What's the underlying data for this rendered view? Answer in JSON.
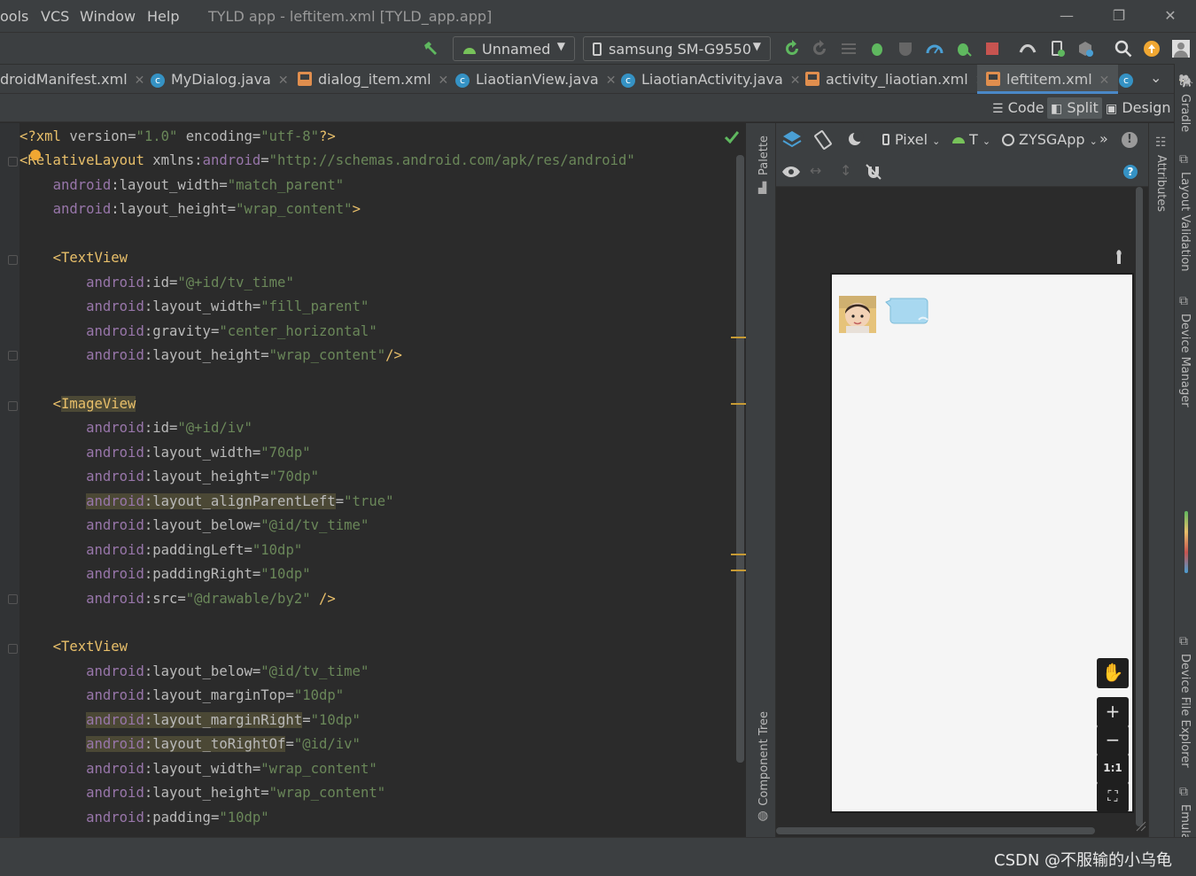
{
  "menu": {
    "items": [
      "ools",
      "VCS",
      "Window",
      "Help"
    ],
    "title": "TYLD app - leftitem.xml [TYLD_app.app]"
  },
  "toolbar": {
    "config_label": "Unnamed",
    "device_label": "samsung SM-G9550"
  },
  "tabs": [
    {
      "label": "droidManifest.xml",
      "kind": "xml"
    },
    {
      "label": "MyDialog.java",
      "kind": "class"
    },
    {
      "label": "dialog_item.xml",
      "kind": "xml"
    },
    {
      "label": "LiaotianView.java",
      "kind": "class"
    },
    {
      "label": "LiaotianActivity.java",
      "kind": "class"
    },
    {
      "label": "activity_liaotian.xml",
      "kind": "xml"
    },
    {
      "label": "leftitem.xml",
      "kind": "xml",
      "active": true
    }
  ],
  "modes": {
    "code": "Code",
    "split": "Split",
    "design": "Design",
    "active": "Split"
  },
  "design_toolbar": {
    "device": "Pixel",
    "api": "T",
    "theme": "ZYSGApp"
  },
  "side_panels": {
    "palette": "Palette",
    "component_tree": "Component Tree",
    "attributes": "Attributes",
    "gradle": "Gradle",
    "layout_validation": "Layout Validation",
    "device_manager": "Device Manager",
    "device_file_explorer": "Device File Explorer",
    "emulator": "Emulator"
  },
  "zoom": {
    "in": "+",
    "out": "−",
    "one_to_one": "1:1"
  },
  "watermark": "CSDN @不服输的小乌龟",
  "colors": {
    "accent": "#4a88c7",
    "tag": "#e8bf6a",
    "attr_ns": "#9876aa",
    "value": "#6a8759",
    "warning": "#c79b35"
  },
  "code_lines": [
    {
      "parts": [
        [
          "pn",
          "<?"
        ],
        [
          "tg",
          "xml "
        ],
        [
          "at",
          "version"
        ],
        [
          "pl",
          "="
        ],
        [
          "av",
          "\"1.0\""
        ],
        [
          "at",
          " encoding"
        ],
        [
          "pl",
          "="
        ],
        [
          "av",
          "\"utf-8\""
        ],
        [
          "pn",
          "?>"
        ]
      ]
    },
    {
      "parts": [
        [
          "pn",
          "<"
        ],
        [
          "tg",
          "RelativeLayout "
        ],
        [
          "at",
          "xmlns"
        ],
        [
          "pl",
          ":"
        ],
        [
          "an",
          "android"
        ],
        [
          "pl",
          "="
        ],
        [
          "av",
          "\"http://schemas.android.com/apk/res/android\""
        ]
      ]
    },
    {
      "parts": [
        [
          "pl",
          "    "
        ],
        [
          "an",
          "android"
        ],
        [
          "pl",
          ":"
        ],
        [
          "at",
          "layout_width"
        ],
        [
          "pl",
          "="
        ],
        [
          "av",
          "\"match_parent\""
        ]
      ]
    },
    {
      "parts": [
        [
          "pl",
          "    "
        ],
        [
          "an",
          "android"
        ],
        [
          "pl",
          ":"
        ],
        [
          "at",
          "layout_height"
        ],
        [
          "pl",
          "="
        ],
        [
          "av",
          "\"wrap_content\""
        ],
        [
          "pn",
          ">"
        ]
      ]
    },
    {
      "parts": []
    },
    {
      "parts": [
        [
          "pl",
          "    "
        ],
        [
          "pn",
          "<"
        ],
        [
          "tg",
          "TextView"
        ]
      ]
    },
    {
      "parts": [
        [
          "pl",
          "        "
        ],
        [
          "an",
          "android"
        ],
        [
          "pl",
          ":"
        ],
        [
          "at",
          "id"
        ],
        [
          "pl",
          "="
        ],
        [
          "av",
          "\"@+id/tv_time\""
        ]
      ]
    },
    {
      "parts": [
        [
          "pl",
          "        "
        ],
        [
          "an",
          "android"
        ],
        [
          "pl",
          ":"
        ],
        [
          "at",
          "layout_width"
        ],
        [
          "pl",
          "="
        ],
        [
          "av",
          "\"fill_parent\""
        ]
      ]
    },
    {
      "parts": [
        [
          "pl",
          "        "
        ],
        [
          "an",
          "android"
        ],
        [
          "pl",
          ":"
        ],
        [
          "at",
          "gravity"
        ],
        [
          "pl",
          "="
        ],
        [
          "av",
          "\"center_horizontal\""
        ]
      ]
    },
    {
      "parts": [
        [
          "pl",
          "        "
        ],
        [
          "an",
          "android"
        ],
        [
          "pl",
          ":"
        ],
        [
          "at",
          "layout_height"
        ],
        [
          "pl",
          "="
        ],
        [
          "av",
          "\"wrap_content\""
        ],
        [
          "pn",
          "/>"
        ]
      ]
    },
    {
      "parts": []
    },
    {
      "parts": [
        [
          "pl",
          "    "
        ],
        [
          "pn",
          "<"
        ],
        [
          "tg",
          "ImageView",
          "hl"
        ]
      ]
    },
    {
      "parts": [
        [
          "pl",
          "        "
        ],
        [
          "an",
          "android"
        ],
        [
          "pl",
          ":"
        ],
        [
          "at",
          "id"
        ],
        [
          "pl",
          "="
        ],
        [
          "av",
          "\"@+id/iv\""
        ]
      ]
    },
    {
      "parts": [
        [
          "pl",
          "        "
        ],
        [
          "an",
          "android"
        ],
        [
          "pl",
          ":"
        ],
        [
          "at",
          "layout_width"
        ],
        [
          "pl",
          "="
        ],
        [
          "av",
          "\"70dp\""
        ]
      ]
    },
    {
      "parts": [
        [
          "pl",
          "        "
        ],
        [
          "an",
          "android"
        ],
        [
          "pl",
          ":"
        ],
        [
          "at",
          "layout_height"
        ],
        [
          "pl",
          "="
        ],
        [
          "av",
          "\"70dp\""
        ]
      ]
    },
    {
      "parts": [
        [
          "pl",
          "        "
        ],
        [
          "an",
          "android",
          "hl"
        ],
        [
          "at",
          ":layout_alignParentLeft",
          "hl"
        ],
        [
          "pl",
          "="
        ],
        [
          "av",
          "\"true\""
        ]
      ]
    },
    {
      "parts": [
        [
          "pl",
          "        "
        ],
        [
          "an",
          "android"
        ],
        [
          "pl",
          ":"
        ],
        [
          "at",
          "layout_below"
        ],
        [
          "pl",
          "="
        ],
        [
          "av",
          "\"@id/tv_time\""
        ]
      ]
    },
    {
      "parts": [
        [
          "pl",
          "        "
        ],
        [
          "an",
          "android"
        ],
        [
          "pl",
          ":"
        ],
        [
          "at",
          "paddingLeft"
        ],
        [
          "pl",
          "="
        ],
        [
          "av",
          "\"10dp\""
        ]
      ]
    },
    {
      "parts": [
        [
          "pl",
          "        "
        ],
        [
          "an",
          "android"
        ],
        [
          "pl",
          ":"
        ],
        [
          "at",
          "paddingRight"
        ],
        [
          "pl",
          "="
        ],
        [
          "av",
          "\"10dp\""
        ]
      ]
    },
    {
      "parts": [
        [
          "pl",
          "        "
        ],
        [
          "an",
          "android"
        ],
        [
          "pl",
          ":"
        ],
        [
          "at",
          "src"
        ],
        [
          "pl",
          "="
        ],
        [
          "av",
          "\"@drawable/by2\""
        ],
        [
          "pn",
          " />"
        ]
      ]
    },
    {
      "parts": []
    },
    {
      "parts": [
        [
          "pl",
          "    "
        ],
        [
          "pn",
          "<"
        ],
        [
          "tg",
          "TextView"
        ]
      ]
    },
    {
      "parts": [
        [
          "pl",
          "        "
        ],
        [
          "an",
          "android"
        ],
        [
          "pl",
          ":"
        ],
        [
          "at",
          "layout_below"
        ],
        [
          "pl",
          "="
        ],
        [
          "av",
          "\"@id/tv_time\""
        ]
      ]
    },
    {
      "parts": [
        [
          "pl",
          "        "
        ],
        [
          "an",
          "android"
        ],
        [
          "pl",
          ":"
        ],
        [
          "at",
          "layout_marginTop"
        ],
        [
          "pl",
          "="
        ],
        [
          "av",
          "\"10dp\""
        ]
      ]
    },
    {
      "parts": [
        [
          "pl",
          "        "
        ],
        [
          "an",
          "android",
          "hl"
        ],
        [
          "at",
          ":layout_marginRight",
          "hl"
        ],
        [
          "pl",
          "="
        ],
        [
          "av",
          "\"10dp\""
        ]
      ]
    },
    {
      "parts": [
        [
          "pl",
          "        "
        ],
        [
          "an",
          "android",
          "hl"
        ],
        [
          "at",
          ":layout_toRightOf",
          "hl"
        ],
        [
          "pl",
          "="
        ],
        [
          "av",
          "\"@id/iv\""
        ]
      ]
    },
    {
      "parts": [
        [
          "pl",
          "        "
        ],
        [
          "an",
          "android"
        ],
        [
          "pl",
          ":"
        ],
        [
          "at",
          "layout_width"
        ],
        [
          "pl",
          "="
        ],
        [
          "av",
          "\"wrap_content\""
        ]
      ]
    },
    {
      "parts": [
        [
          "pl",
          "        "
        ],
        [
          "an",
          "android"
        ],
        [
          "pl",
          ":"
        ],
        [
          "at",
          "layout_height"
        ],
        [
          "pl",
          "="
        ],
        [
          "av",
          "\"wrap_content\""
        ]
      ]
    },
    {
      "parts": [
        [
          "pl",
          "        "
        ],
        [
          "an",
          "android"
        ],
        [
          "pl",
          ":"
        ],
        [
          "at",
          "padding"
        ],
        [
          "pl",
          "="
        ],
        [
          "av",
          "\"10dp\""
        ]
      ]
    }
  ]
}
